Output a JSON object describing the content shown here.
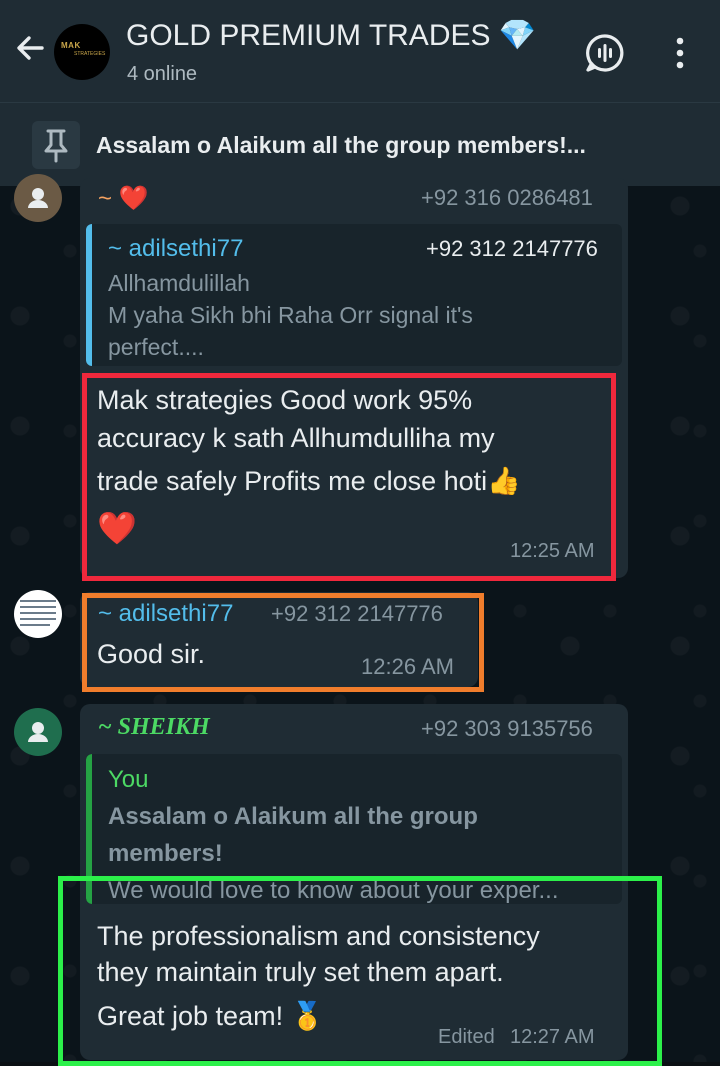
{
  "header": {
    "title": "GOLD PREMIUM TRADES 💎",
    "subtitle": "4 online"
  },
  "pinned": {
    "text": "Assalam o Alaikum all the group members!..."
  },
  "messages": [
    {
      "sender": "~ ❤️",
      "phone": "+92 316 0286481",
      "quote": {
        "author": "~ adilsethi77",
        "phone": "+92 312 2147776",
        "lines": [
          "Allhamdulillah",
          "M yaha Sikh bhi Raha Orr signal it's",
          "perfect...."
        ]
      },
      "text_lines": [
        "Mak strategies Good work 95%",
        "accuracy k sath Allhumdulliha my",
        "trade safely Profits me close hoti👍",
        "❤️"
      ],
      "time": "12:25 AM"
    },
    {
      "sender": "~ adilsethi77",
      "phone": "+92 312 2147776",
      "text": "Good sir.",
      "time": "12:26 AM"
    },
    {
      "sender": "~ SHEIKH",
      "phone": "+92 303 9135756",
      "quote": {
        "author": "You",
        "lines": [
          "Assalam o Alaikum all the group",
          "members!",
          "We would love to know about your exper..."
        ]
      },
      "text_lines": [
        "The professionalism and consistency",
        "they maintain truly set them apart.",
        "Great job team! 🥇"
      ],
      "edited": "Edited",
      "time": "12:27 AM"
    }
  ],
  "group_logo": {
    "line1": "MAK",
    "line2": "STRATEGIES"
  },
  "colors": {
    "header_bg": "#1f2c34",
    "bubble_bg": "#1f2c34",
    "highlight_red": "#f0283c",
    "highlight_orange": "#f07d2c",
    "highlight_green": "#2cf04a",
    "sender_blue": "#53bdeb",
    "sender_green": "#4cd964"
  }
}
